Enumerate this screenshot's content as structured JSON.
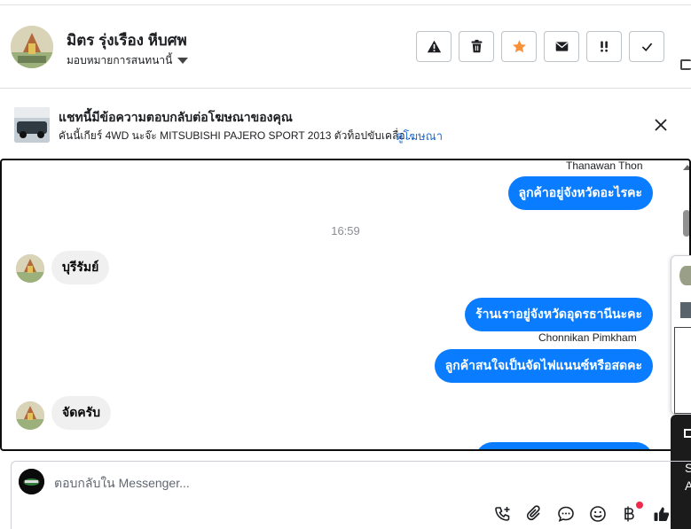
{
  "header": {
    "contact_name": "มิตร รุ่งเรือง หีบศพ",
    "assign_label": "มอบหมายการสนทนานี้",
    "actions": [
      {
        "name": "spam-button",
        "icon": "warning-icon"
      },
      {
        "name": "delete-button",
        "icon": "trash-icon"
      },
      {
        "name": "star-button",
        "icon": "star-icon"
      },
      {
        "name": "mark-unread-button",
        "icon": "envelope-icon"
      },
      {
        "name": "follow-up-button",
        "icon": "exclamation-icon"
      },
      {
        "name": "mark-done-button",
        "icon": "check-icon"
      }
    ]
  },
  "banner": {
    "title": "แชทนี้มีข้อความตอบกลับต่อโฆษณาของคุณ",
    "description": "คันนี้เกียร์ 4WD นะจ๊ะ MITSUBISHI PAJERO SPORT 2013 ตัวท็อปขับเคลื่อ...",
    "link_label": "ดูโฆษณา"
  },
  "chat": {
    "messages": [
      {
        "sender": "Thanawan Thon",
        "text": "ลูกค้าอยู่จังหวัดอะไรคะ",
        "direction": "out"
      },
      {
        "timestamp": "16:59"
      },
      {
        "text": "บุรีรัมย์",
        "direction": "in"
      },
      {
        "text": "ร้านเราอยู่จังหวัดอุดรธานีนะคะ",
        "direction": "out"
      },
      {
        "sender": "Chonnikan Pimkham",
        "text": "ลูกค้าสนใจเป็นจัดไฟแนนซ์หรือสดคะ",
        "direction": "out"
      },
      {
        "text": "จัดครับ",
        "direction": "in"
      }
    ]
  },
  "side_popup": {
    "line1": "S",
    "line2": "A"
  },
  "composer": {
    "placeholder": "ตอบกลับใน Messenger...",
    "tools": [
      "call-icon",
      "attachment-icon",
      "saved-reply-icon",
      "emoji-icon",
      "baht-payment-icon",
      "thumbs-up-icon"
    ]
  },
  "colors": {
    "outgoing_bubble": "#0a7cff",
    "incoming_bubble": "#f0f0f0",
    "star": "#f7923b",
    "link": "#216fdb",
    "notification_dot": "#f02849"
  }
}
